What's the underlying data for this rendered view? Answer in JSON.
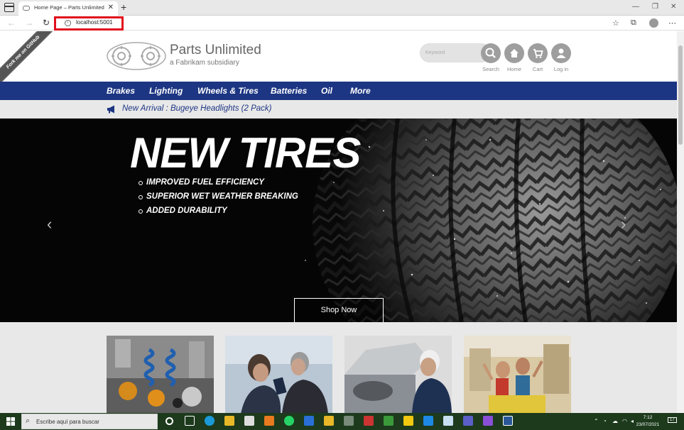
{
  "browser": {
    "tab_title": "Home Page – Parts Unlimited",
    "url": "localhost:5001"
  },
  "site": {
    "fork_ribbon": "Fork me on GitHub",
    "logo_title": "Parts Unlimited",
    "logo_subtitle": "a Fabrikam subsidiary",
    "search_placeholder": "Keyword",
    "header_actions": [
      {
        "label": "Search",
        "icon": "search-icon"
      },
      {
        "label": "Home",
        "icon": "home-icon"
      },
      {
        "label": "Cart",
        "icon": "cart-icon"
      },
      {
        "label": "Log in",
        "icon": "user-icon"
      }
    ],
    "nav": [
      "Brakes",
      "Lighting",
      "Wheels & Tires",
      "Batteries",
      "Oil",
      "More"
    ],
    "promo": "New Arrival : Bugeye Headlights (2 Pack)",
    "hero": {
      "title": "NEW TIRES",
      "features": [
        "IMPROVED FUEL EFFICIENCY",
        "SUPERIOR WET WEATHER BREAKING",
        "ADDED DURABILITY"
      ],
      "cta": "Shop Now",
      "slide_count": 3,
      "active_slide": 2
    },
    "cards": [
      "parts-image",
      "customer-service-image",
      "mechanic-image",
      "happy-customers-image"
    ]
  },
  "taskbar": {
    "search_text": "Escribe aquí para buscar",
    "time": "7:12",
    "date": "23/07/2021",
    "notifications": "17"
  },
  "colors": {
    "nav_blue": "#1d3683",
    "url_highlight": "#e0101c",
    "hero_bg": "#050505"
  }
}
